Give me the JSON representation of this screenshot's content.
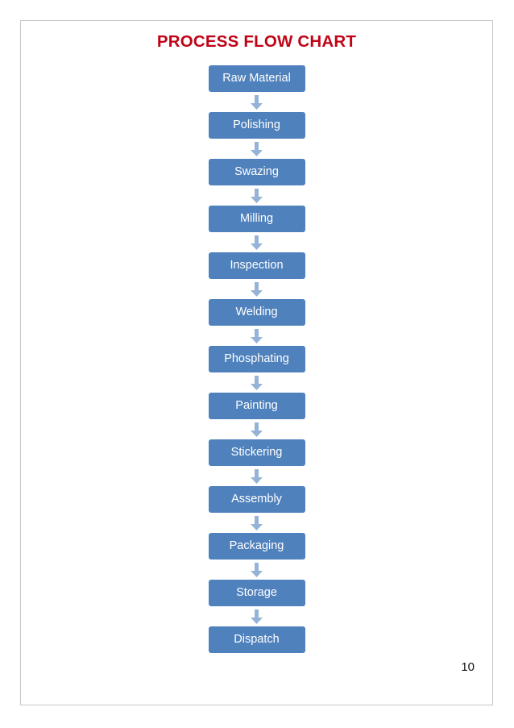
{
  "page": {
    "title": "PROCESS FLOW CHART",
    "title_color": "#C00418",
    "page_number": "10",
    "border_color": "#C6C6C6",
    "background": "#FFFFFF"
  },
  "flowchart": {
    "type": "flowchart",
    "orientation": "vertical",
    "box_fill": "#4F81BD",
    "box_text_color": "#FFFFFF",
    "arrow_color": "#95B3D7",
    "arrow_icon": "arrow-down-icon",
    "steps": [
      {
        "index": 1,
        "label": "Raw Material"
      },
      {
        "index": 2,
        "label": "Polishing"
      },
      {
        "index": 3,
        "label": "Swazing"
      },
      {
        "index": 4,
        "label": "Milling"
      },
      {
        "index": 5,
        "label": "Inspection"
      },
      {
        "index": 6,
        "label": "Welding"
      },
      {
        "index": 7,
        "label": "Phosphating"
      },
      {
        "index": 8,
        "label": "Painting"
      },
      {
        "index": 9,
        "label": "Stickering"
      },
      {
        "index": 10,
        "label": "Assembly"
      },
      {
        "index": 11,
        "label": "Packaging"
      },
      {
        "index": 12,
        "label": "Storage"
      },
      {
        "index": 13,
        "label": "Dispatch"
      }
    ]
  }
}
